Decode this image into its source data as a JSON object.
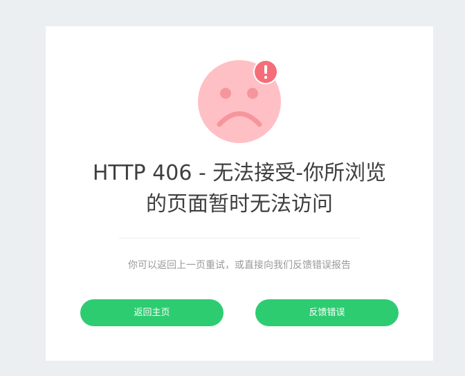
{
  "error": {
    "title_line1": "HTTP 406 - 无法接受-你所浏览",
    "title_line2": "的页面暂时无法访问",
    "message": "你可以返回上一页重试，或直接向我们反馈错误报告"
  },
  "actions": {
    "home_label": "返回主页",
    "report_label": "反馈错误"
  },
  "icons": {
    "face": "sad-face-icon",
    "alert": "exclamation-badge-icon"
  },
  "colors": {
    "background": "#eceff2",
    "card": "#ffffff",
    "face": "#ffc0c5",
    "face_features": "#f7959d",
    "alert_badge": "#f46e79",
    "button": "#2ecc71",
    "title_text": "#3e3e3e",
    "message_text": "#999999"
  }
}
